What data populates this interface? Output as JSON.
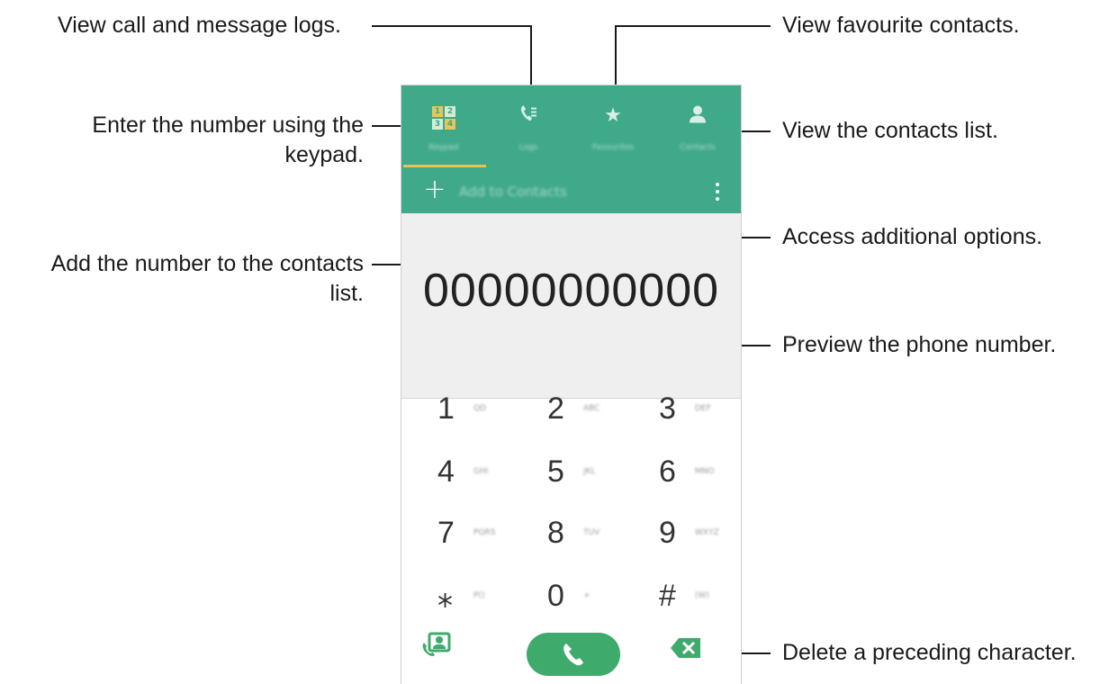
{
  "annotations": {
    "logs": "View call and message logs.",
    "favourites": "View favourite contacts.",
    "keypad_line1": "Enter the number using the",
    "keypad_line2": "keypad.",
    "contacts_list": "View the contacts list.",
    "options": "Access additional options.",
    "add_line1": "Add the number to the contacts",
    "add_line2": "list.",
    "preview": "Preview the phone number.",
    "delete": "Delete a preceding character."
  },
  "tabs": [
    {
      "label": "Keypad",
      "icon": "keypad-icon",
      "selected": true
    },
    {
      "label": "Logs",
      "icon": "call-log-icon",
      "selected": false
    },
    {
      "label": "Favourites",
      "icon": "star-icon",
      "selected": false
    },
    {
      "label": "Contacts",
      "icon": "person-icon",
      "selected": false
    }
  ],
  "actionbar": {
    "add_label": "Add to Contacts",
    "plus": "+"
  },
  "keypad_icon_digits": [
    "1",
    "2",
    "3",
    "4"
  ],
  "display_number": "00000000000",
  "keys": [
    {
      "digit": "1",
      "letters": "QD"
    },
    {
      "digit": "2",
      "letters": "ABC"
    },
    {
      "digit": "3",
      "letters": "DEF"
    },
    {
      "digit": "4",
      "letters": "GHI"
    },
    {
      "digit": "5",
      "letters": "JKL"
    },
    {
      "digit": "6",
      "letters": "MNO"
    },
    {
      "digit": "7",
      "letters": "PQRS"
    },
    {
      "digit": "8",
      "letters": "TUV"
    },
    {
      "digit": "9",
      "letters": "WXYZ"
    },
    {
      "digit": "⁎",
      "letters": "P()"
    },
    {
      "digit": "0",
      "letters": "+"
    },
    {
      "digit": "#",
      "letters": "(W)"
    }
  ],
  "colors": {
    "accent": "#3fa98a",
    "call_button": "#3eaa6c",
    "underline": "#e7c357",
    "display_bg": "#efefef"
  }
}
